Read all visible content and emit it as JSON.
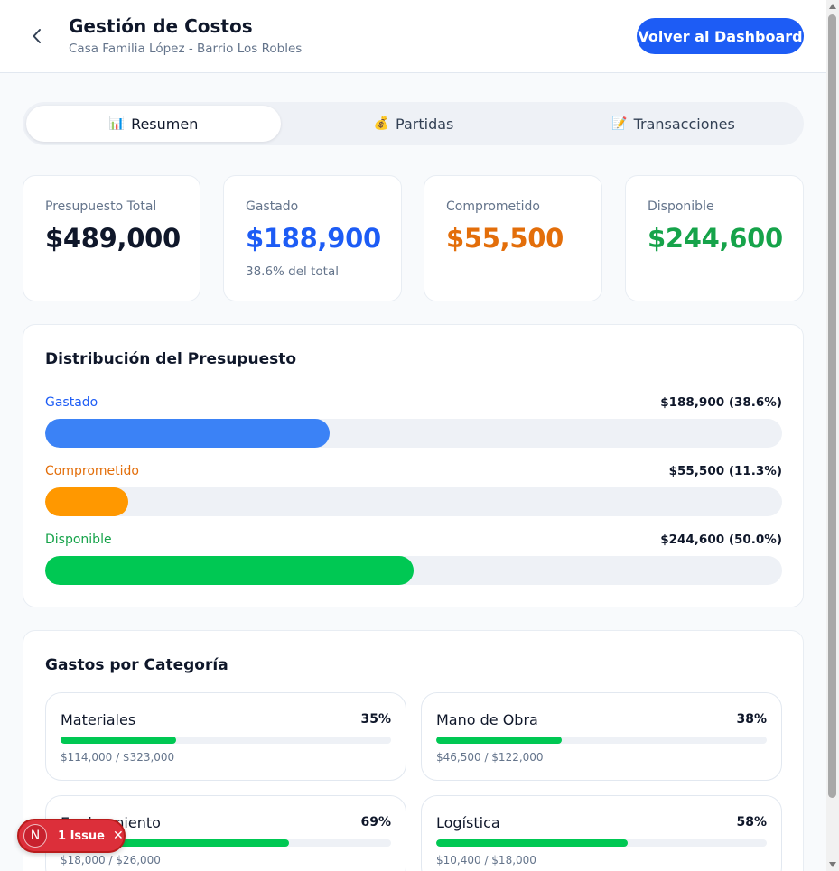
{
  "header": {
    "title": "Gestión de Costos",
    "subtitle": "Casa Familia López - Barrio Los Robles",
    "back_icon": "chevron-left-icon",
    "dashboard_button": "Volver al Dashboard"
  },
  "tabs": [
    {
      "label": "Resumen",
      "icon": "📊",
      "active": true
    },
    {
      "label": "Partidas",
      "icon": "💰",
      "active": false
    },
    {
      "label": "Transacciones",
      "icon": "📝",
      "active": false
    }
  ],
  "stats": [
    {
      "label": "Presupuesto Total",
      "value": "$489,000",
      "note": "",
      "color": "#0f172a"
    },
    {
      "label": "Gastado",
      "value": "$188,900",
      "note": "38.6% del total",
      "color": "#1d5cf5"
    },
    {
      "label": "Comprometido",
      "value": "$55,500",
      "note": "",
      "color": "#e36e0a"
    },
    {
      "label": "Disponible",
      "value": "$244,600",
      "note": "",
      "color": "#16a34a"
    }
  ],
  "distribution": {
    "title": "Distribución del Presupuesto",
    "rows": [
      {
        "label": "Gastado",
        "amount": "$188,900 (38.6%)",
        "fraction": 0.386,
        "label_color": "#1d5cf5",
        "bar_color": "#3b82f6"
      },
      {
        "label": "Comprometido",
        "amount": "$55,500 (11.3%)",
        "fraction": 0.113,
        "label_color": "#e36e0a",
        "bar_color": "#ff9800"
      },
      {
        "label": "Disponible",
        "amount": "$244,600 (50.0%)",
        "fraction": 0.5,
        "label_color": "#16a34a",
        "bar_color": "#00c853"
      }
    ]
  },
  "categories": {
    "title": "Gastos por Categoría",
    "items": [
      {
        "name": "Materiales",
        "percent": "35%",
        "fraction": 0.35,
        "amount": "$114,000 / $323,000"
      },
      {
        "name": "Mano de Obra",
        "percent": "38%",
        "fraction": 0.38,
        "amount": "$46,500 / $122,000"
      },
      {
        "name": "Equipamiento",
        "percent": "69%",
        "fraction": 0.69,
        "amount": "$18,000 / $26,000"
      },
      {
        "name": "Logística",
        "percent": "58%",
        "fraction": 0.58,
        "amount": "$10,400 / $18,000"
      }
    ]
  },
  "issue_badge": {
    "avatar_letter": "N",
    "text": "1 Issue",
    "close_icon": "close-icon"
  }
}
